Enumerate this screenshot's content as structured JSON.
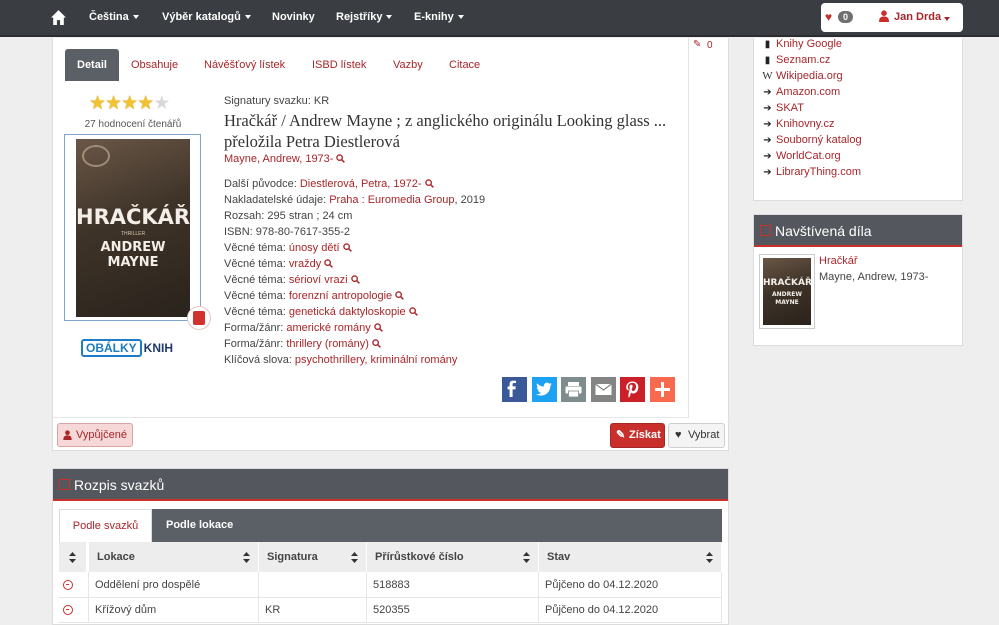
{
  "nav": {
    "items": [
      "Čeština",
      "Výběr katalogů",
      "Novinky",
      "Rejstříky",
      "E-knihy"
    ],
    "favorites_count": "0",
    "user_name": "Jan Drda"
  },
  "detail": {
    "edit_count": "0",
    "tabs": [
      "Detail",
      "Obsahuje",
      "Návěšťový lístek",
      "ISBD lístek",
      "Vazby",
      "Citace"
    ],
    "rating": {
      "value": 4,
      "max": 5,
      "text": "27 hodnocení čtenářů"
    },
    "cover": {
      "title_line1": "HRAČKÁŘ",
      "subtitle": "THRILLER",
      "author_line1": "ANDREW",
      "author_line2": "MAYNE"
    },
    "obalky": {
      "part1": "OBÁLKY",
      "part2": "KNIH"
    },
    "signatury": "Signatury svazku: KR",
    "title": "Hračkář / Andrew Mayne ; z anglického originálu Looking glass ... přeložila Petra Diestlerová",
    "author": "Mayne, Andrew, 1973-",
    "fields": [
      {
        "label": "Další původce: ",
        "value": "Diestlerová, Petra, 1972-",
        "search": true
      },
      {
        "label": "Nakladatelské údaje: ",
        "value": "Praha : Euromedia Group",
        "suffix": ", 2019",
        "search": false
      },
      {
        "label": "Rozsah: 295 stran ; 24 cm",
        "value": "",
        "search": false
      },
      {
        "label": "ISBN: 978-80-7617-355-2",
        "value": "",
        "search": false
      },
      {
        "label": "Věcné téma: ",
        "value": "únosy dětí",
        "search": true
      },
      {
        "label": "Věcné téma: ",
        "value": "vraždy",
        "search": true
      },
      {
        "label": "Věcné téma: ",
        "value": "sérioví vrazi",
        "search": true
      },
      {
        "label": "Věcné téma: ",
        "value": "forenzní antropologie",
        "search": true
      },
      {
        "label": "Věcné téma: ",
        "value": "genetická daktyloskopie",
        "search": true
      },
      {
        "label": "Forma/žánr: ",
        "value": "americké romány",
        "search": true
      },
      {
        "label": "Forma/žánr: ",
        "value": "thrillery (romány)",
        "search": true
      },
      {
        "label": "Klíčová slova: ",
        "value": "psychothrillery, kriminální romány",
        "search": false
      }
    ],
    "share": [
      {
        "name": "facebook",
        "color": "#3b5998"
      },
      {
        "name": "twitter",
        "color": "#1da1f2"
      },
      {
        "name": "print",
        "color": "#7f8c8d"
      },
      {
        "name": "email",
        "color": "#848484"
      },
      {
        "name": "pinterest",
        "color": "#cb2027"
      },
      {
        "name": "more",
        "color": "#f8694d"
      }
    ],
    "btn_vypujcene": "Vypůjčené",
    "btn_ziskat": "Získat",
    "btn_vybrat": "Vybrat"
  },
  "rozpis": {
    "title": "Rozpis svazků",
    "subtabs": [
      "Podle svazků",
      "Podle lokace"
    ],
    "columns": [
      "Lokace",
      "Signatura",
      "Přírůstkové číslo",
      "Stav"
    ],
    "rows": [
      [
        "Oddělení pro dospělé",
        "",
        "518883",
        "Půjčeno do 04.12.2020"
      ],
      [
        "Křížový dům",
        "KR",
        "520355",
        "Půjčeno do 04.12.2020"
      ]
    ]
  },
  "sidebar": {
    "links": [
      {
        "icon": "book",
        "label": "Knihy Google"
      },
      {
        "icon": "book",
        "label": "Seznam.cz"
      },
      {
        "icon": "wikipedia",
        "label": "Wikipedia.org"
      },
      {
        "icon": "share-arrow",
        "label": "Amazon.com"
      },
      {
        "icon": "share-arrow",
        "label": "SKAT"
      },
      {
        "icon": "share-arrow",
        "label": "Knihovny.cz"
      },
      {
        "icon": "share-arrow",
        "label": "Souborný katalog"
      },
      {
        "icon": "share-arrow",
        "label": "WorldCat.org"
      },
      {
        "icon": "share-arrow",
        "label": "LibraryThing.com"
      }
    ],
    "visited_title": "Navštívená díla",
    "visited_item_title": "Hračkář",
    "visited_item_author": "Mayne, Andrew, 1973-"
  }
}
